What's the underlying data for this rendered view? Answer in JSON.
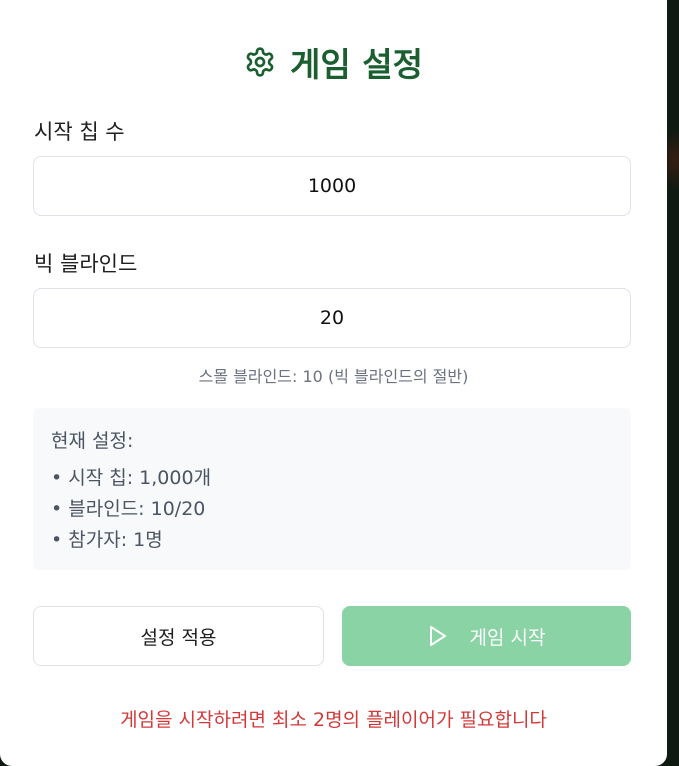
{
  "title": "게임 설정",
  "title_icon": "gear-icon",
  "colors": {
    "title": "#1b5e30",
    "start_button_bg": "#8ad3a5",
    "warning": "#d23a3a"
  },
  "starting_chips": {
    "label": "시작 칩 수",
    "value": "1000"
  },
  "big_blind": {
    "label": "빅 블라인드",
    "value": "20"
  },
  "small_blind_hint": "스몰 블라인드: 10 (빅 블라인드의 절반)",
  "current_settings": {
    "heading": "현재 설정:",
    "items": [
      "시작 칩: 1,000개",
      "블라인드: 10/20",
      "참가자: 1명"
    ]
  },
  "buttons": {
    "apply_label": "설정 적용",
    "start_label": "게임 시작",
    "start_icon": "play-icon"
  },
  "warning_text": "게임을 시작하려면 최소 2명의 플레이어가 필요합니다"
}
